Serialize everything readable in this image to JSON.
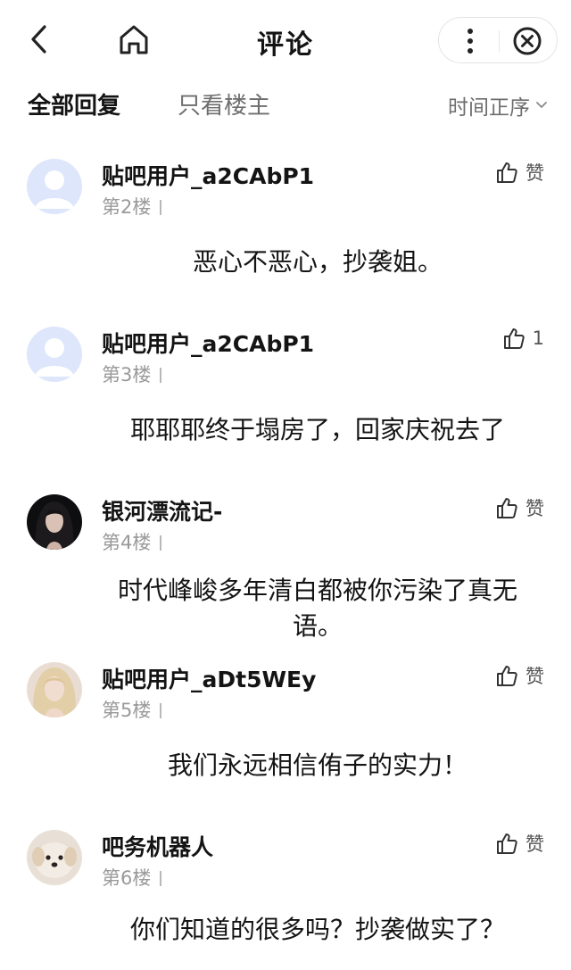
{
  "header": {
    "title": "评论",
    "back_icon": "chevron-left-icon",
    "home_icon": "home-icon",
    "more_icon": "more-vertical-icon",
    "close_icon": "close-circle-icon"
  },
  "filters": {
    "tab_all": "全部回复",
    "tab_op": "只看楼主",
    "sort_label": "时间正序"
  },
  "comments": [
    {
      "user": "贴吧用户_a2CAbP1",
      "floor": "第2楼",
      "like": "赞",
      "content": "恶心不恶心，抄袭姐。",
      "avatar": "default"
    },
    {
      "user": "贴吧用户_a2CAbP1",
      "floor": "第3楼",
      "like": "1",
      "content": "耶耶耶终于塌房了，回家庆祝去了",
      "avatar": "default"
    },
    {
      "user": "银河漂流记-",
      "floor": "第4楼",
      "like": "赞",
      "content": "时代峰峻多年清白都被你污染了真无语。",
      "avatar": "dark-hair"
    },
    {
      "user": "贴吧用户_aDt5WEy",
      "floor": "第5楼",
      "like": "赞",
      "content": "我们永远相信侑子的实力！",
      "avatar": "blonde"
    },
    {
      "user": "吧务机器人",
      "floor": "第6楼",
      "like": "赞",
      "content": "你们知道的很多吗？抄袭做实了？",
      "avatar": "puppy"
    }
  ],
  "colors": {
    "text": "#141414",
    "secondary": "#6e6e6e",
    "muted": "#9a9a9a",
    "default_avatar": "#dde6fb"
  }
}
